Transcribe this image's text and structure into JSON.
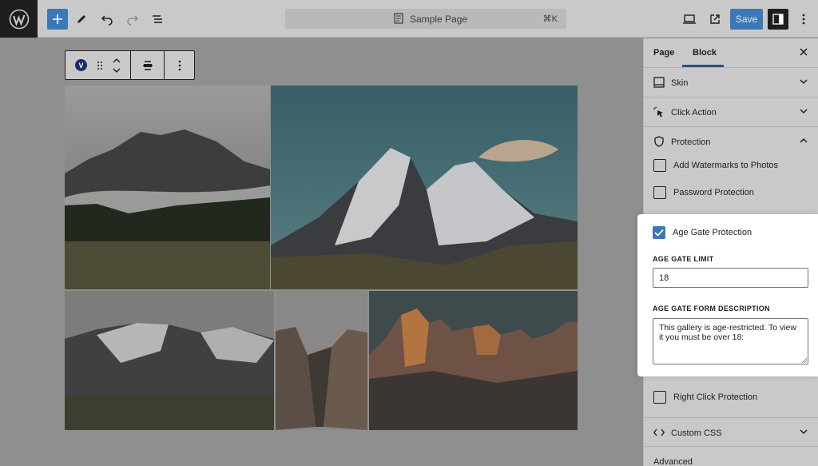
{
  "topbar": {
    "doc_title": "Sample Page",
    "doc_shortcut": "⌘K",
    "save_label": "Save",
    "icons": [
      "wordpress-icon",
      "plus-icon",
      "pencil-icon",
      "undo-icon",
      "redo-icon",
      "list-view-icon",
      "document-icon",
      "desktop-icon",
      "external-link-icon",
      "sidebar-icon",
      "more-vertical-icon"
    ]
  },
  "block_toolbar": {
    "badge": "V",
    "icons": [
      "drag-handle-icon",
      "move-up-down-icon",
      "align-icon",
      "more-vertical-icon"
    ]
  },
  "sidebar": {
    "tabs": [
      "Page",
      "Block"
    ],
    "active_tab": "Block",
    "panels": {
      "skin": "Skin",
      "click_action": "Click Action",
      "protection": "Protection",
      "custom_css": "Custom CSS",
      "advanced": "Advanced"
    },
    "protection_options": {
      "watermarks": "Add Watermarks to Photos",
      "password": "Password Protection",
      "age_gate": "Age Gate Protection",
      "right_click": "Right Click Protection"
    },
    "age_gate": {
      "checked": true,
      "limit_label": "AGE GATE LIMIT",
      "limit_value": "18",
      "description_label": "AGE GATE FORM DESCRIPTION",
      "description_value": "This gallery is age-restricted. To view it you must be over 18:"
    }
  },
  "colors": {
    "accent": "#3b78b8",
    "dark": "#1e1e1e",
    "overlay": "#c9c9c9"
  }
}
